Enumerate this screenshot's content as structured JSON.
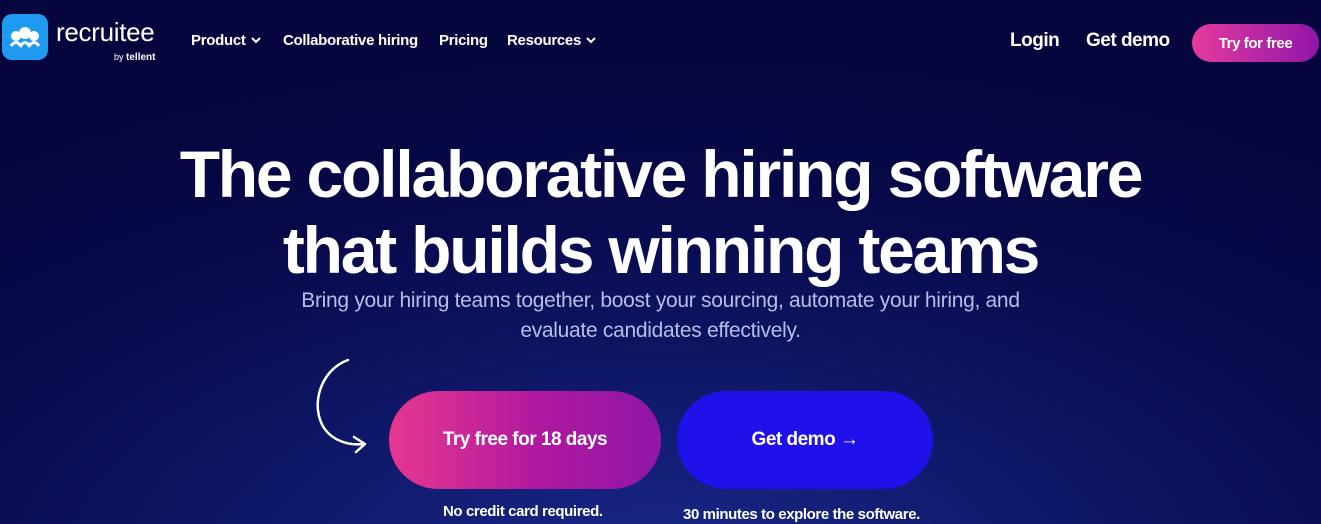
{
  "brand": {
    "name": "recruitee",
    "by_prefix": "by",
    "by_brand": "tellent",
    "accent": "#1e9bf0"
  },
  "nav": {
    "items": [
      {
        "label": "Product",
        "dropdown": true
      },
      {
        "label": "Collaborative hiring",
        "dropdown": false
      },
      {
        "label": "Pricing",
        "dropdown": false
      },
      {
        "label": "Resources",
        "dropdown": true
      }
    ],
    "login": "Login",
    "get_demo": "Get demo",
    "try_free": "Try for free"
  },
  "hero": {
    "title_line1": "The collaborative hiring software",
    "title_line2": "that builds winning teams",
    "subtitle_line1": "Bring your hiring teams together, boost your sourcing, automate your hiring, and",
    "subtitle_line2": "evaluate candidates effectively.",
    "cta_primary": "Try free for 18 days",
    "cta_secondary": "Get demo →",
    "note_primary": "No credit card required.",
    "note_secondary": "30 minutes to explore the software."
  },
  "colors": {
    "background": "#06063f",
    "cta_gradient_start": "#e6378f",
    "cta_gradient_end": "#8f16a8",
    "demo": "#2010ea"
  }
}
